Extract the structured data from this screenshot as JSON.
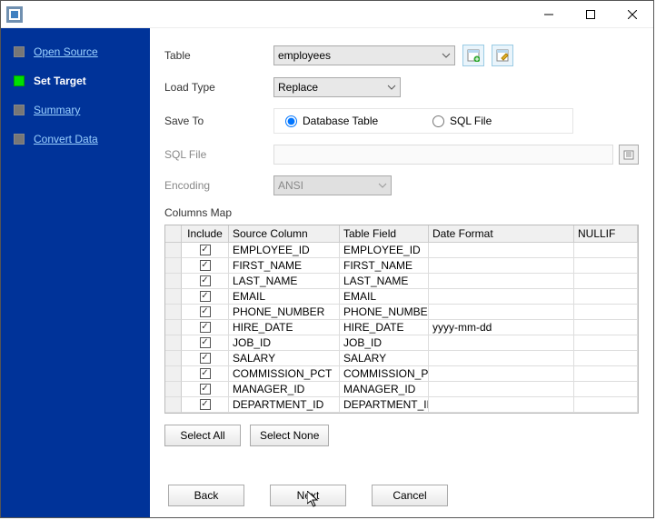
{
  "sidebar": {
    "steps": [
      {
        "label": "Open Source",
        "current": false,
        "link": true
      },
      {
        "label": "Set Target",
        "current": true,
        "link": false
      },
      {
        "label": "Summary",
        "current": false,
        "link": true
      },
      {
        "label": "Convert Data",
        "current": false,
        "link": true
      }
    ]
  },
  "form": {
    "table_label": "Table",
    "table_value": "employees",
    "load_type_label": "Load Type",
    "load_type_value": "Replace",
    "save_to_label": "Save To",
    "radio_database": "Database Table",
    "radio_sqlfile": "SQL File",
    "sqlfile_label": "SQL File",
    "sqlfile_value": "",
    "encoding_label": "Encoding",
    "encoding_value": "ANSI",
    "columns_map_label": "Columns Map"
  },
  "grid": {
    "headers": [
      "",
      "Include",
      "Source Column",
      "Table Field",
      "Date Format",
      "NULLIF"
    ],
    "rows": [
      {
        "include": true,
        "src": "EMPLOYEE_ID",
        "field": "EMPLOYEE_ID",
        "fmt": "",
        "nullif": ""
      },
      {
        "include": true,
        "src": "FIRST_NAME",
        "field": "FIRST_NAME",
        "fmt": "",
        "nullif": ""
      },
      {
        "include": true,
        "src": "LAST_NAME",
        "field": "LAST_NAME",
        "fmt": "",
        "nullif": ""
      },
      {
        "include": true,
        "src": "EMAIL",
        "field": "EMAIL",
        "fmt": "",
        "nullif": ""
      },
      {
        "include": true,
        "src": "PHONE_NUMBER",
        "field": "PHONE_NUMBER",
        "fmt": "",
        "nullif": ""
      },
      {
        "include": true,
        "src": "HIRE_DATE",
        "field": "HIRE_DATE",
        "fmt": "yyyy-mm-dd",
        "nullif": ""
      },
      {
        "include": true,
        "src": "JOB_ID",
        "field": "JOB_ID",
        "fmt": "",
        "nullif": ""
      },
      {
        "include": true,
        "src": "SALARY",
        "field": "SALARY",
        "fmt": "",
        "nullif": ""
      },
      {
        "include": true,
        "src": "COMMISSION_PCT",
        "field": "COMMISSION_PC",
        "fmt": "",
        "nullif": ""
      },
      {
        "include": true,
        "src": "MANAGER_ID",
        "field": "MANAGER_ID",
        "fmt": "",
        "nullif": ""
      },
      {
        "include": true,
        "src": "DEPARTMENT_ID",
        "field": "DEPARTMENT_ID",
        "fmt": "",
        "nullif": ""
      }
    ]
  },
  "buttons": {
    "select_all": "Select All",
    "select_none": "Select None",
    "back": "Back",
    "next": "Next",
    "cancel": "Cancel"
  }
}
